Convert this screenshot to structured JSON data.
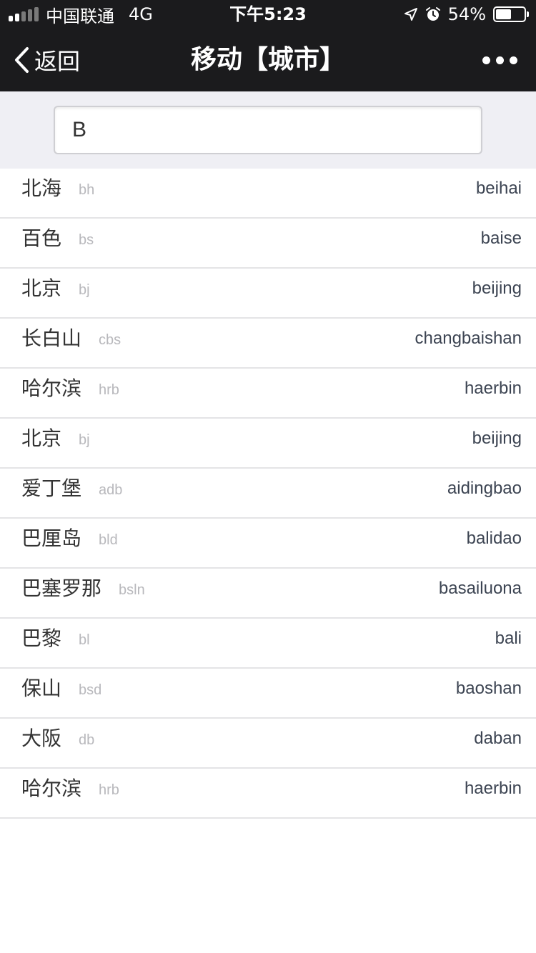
{
  "status_bar": {
    "carrier": "中国联通",
    "network": "4G",
    "time": "下午5:23",
    "battery_percent": "54%",
    "battery_level": 0.54,
    "icons": [
      "signal-icon",
      "location-arrow-icon",
      "alarm-icon",
      "battery-icon"
    ]
  },
  "nav": {
    "back_label": "返回",
    "title": "移动【城市】",
    "icons": [
      "chevron-left-icon",
      "more-dots-icon"
    ]
  },
  "search": {
    "value": "B",
    "placeholder": ""
  },
  "cities": [
    {
      "name": "北海",
      "abbr": "bh",
      "pinyin": "beihai"
    },
    {
      "name": "百色",
      "abbr": "bs",
      "pinyin": "baise"
    },
    {
      "name": "北京",
      "abbr": "bj",
      "pinyin": "beijing"
    },
    {
      "name": "长白山",
      "abbr": "cbs",
      "pinyin": "changbaishan"
    },
    {
      "name": "哈尔滨",
      "abbr": "hrb",
      "pinyin": "haerbin"
    },
    {
      "name": "北京",
      "abbr": "bj",
      "pinyin": "beijing"
    },
    {
      "name": "爱丁堡",
      "abbr": "adb",
      "pinyin": "aidingbao"
    },
    {
      "name": "巴厘岛",
      "abbr": "bld",
      "pinyin": "balidao"
    },
    {
      "name": "巴塞罗那",
      "abbr": "bsln",
      "pinyin": "basailuona"
    },
    {
      "name": "巴黎",
      "abbr": "bl",
      "pinyin": "bali"
    },
    {
      "name": "保山",
      "abbr": "bsd",
      "pinyin": "baoshan"
    },
    {
      "name": "大阪",
      "abbr": "db",
      "pinyin": "daban"
    },
    {
      "name": "哈尔滨",
      "abbr": "hrb",
      "pinyin": "haerbin"
    }
  ]
}
